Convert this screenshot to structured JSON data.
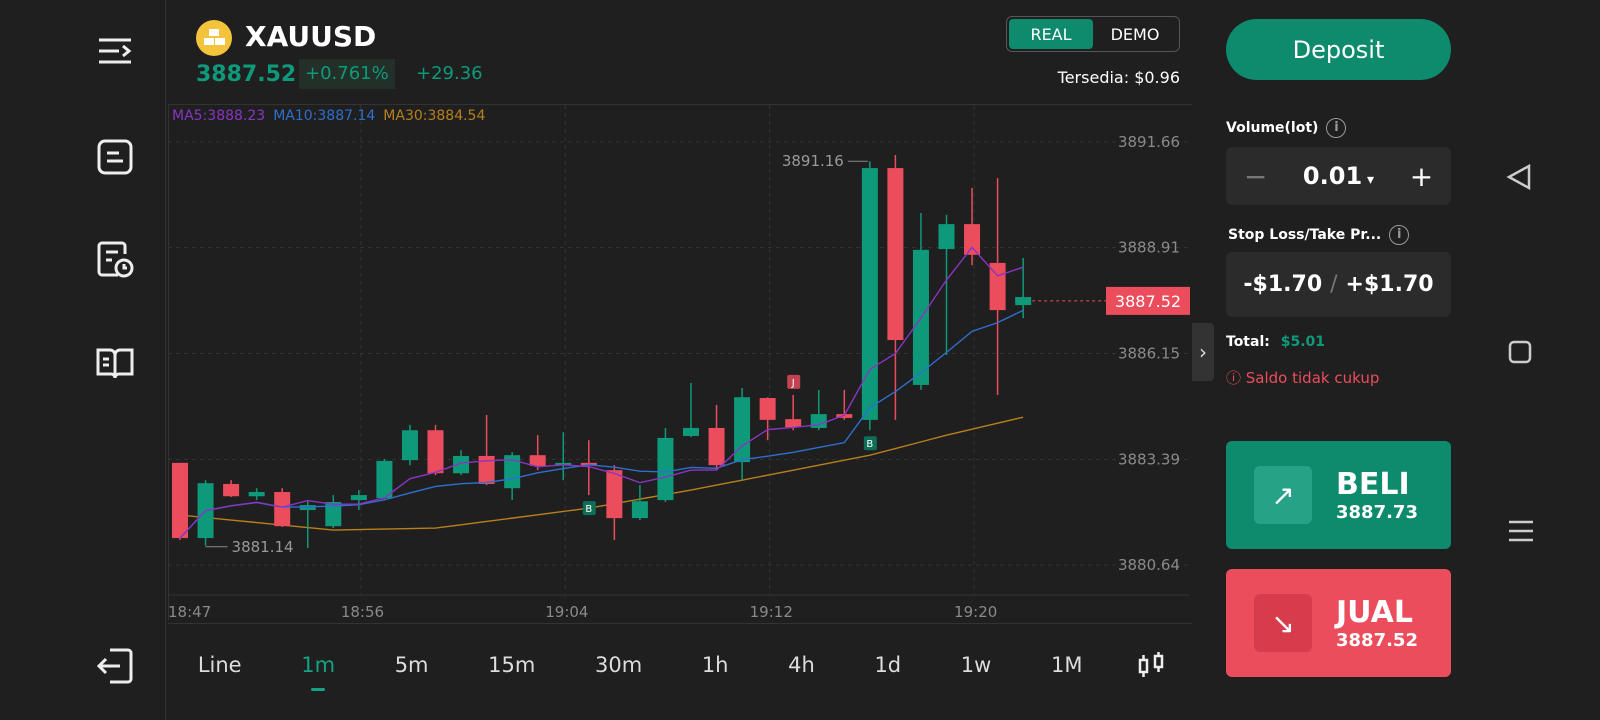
{
  "header": {
    "symbol": "XAUUSD",
    "price": "3887.52",
    "change_pct": "+0.761%",
    "change": "+29.36",
    "account_real": "REAL",
    "account_demo": "DEMO",
    "available": "Tersedia: $0.96"
  },
  "indicators": {
    "ma5": "MA5:3888.23",
    "ma10": "MA10:3887.14",
    "ma30": "MA30:3884.54"
  },
  "colors": {
    "up": "#0e9a7a",
    "down": "#ec4d5c",
    "ma5": "#8a34c4",
    "ma10": "#2e6fd0",
    "ma30": "#b8801c"
  },
  "chart_data": {
    "type": "candlestick",
    "ylim": [
      3880.0,
      3892.6
    ],
    "price_ticks": [
      "3891.66",
      "3888.91",
      "3886.15",
      "3883.39",
      "3880.64"
    ],
    "time_ticks": [
      "18:47",
      "18:56",
      "19:04",
      "19:12",
      "19:20"
    ],
    "time_tick_index": [
      0,
      7,
      15,
      23,
      31
    ],
    "current_price": "3887.52",
    "high_label": "3891.16",
    "high_index": 27,
    "low_label": "3881.14",
    "low_index": 1,
    "markers": [
      {
        "index": 16,
        "label": "B",
        "pos": "below"
      },
      {
        "index": 24,
        "label": "J",
        "pos": "above"
      },
      {
        "index": 27,
        "label": "B",
        "pos": "below"
      }
    ],
    "ohlc": [
      [
        3883.3,
        3883.3,
        3881.29,
        3881.34
      ],
      [
        3881.34,
        3882.85,
        3881.14,
        3882.77
      ],
      [
        3882.75,
        3882.85,
        3882.41,
        3882.43
      ],
      [
        3882.43,
        3882.64,
        3882.33,
        3882.54
      ],
      [
        3882.54,
        3882.64,
        3881.63,
        3881.65
      ],
      [
        3882.07,
        3882.33,
        3881.08,
        3882.2
      ],
      [
        3881.65,
        3882.46,
        3881.6,
        3882.28
      ],
      [
        3882.33,
        3882.59,
        3882.07,
        3882.46
      ],
      [
        3882.38,
        3883.4,
        3882.33,
        3883.35
      ],
      [
        3883.37,
        3884.29,
        3883.24,
        3884.15
      ],
      [
        3884.15,
        3884.29,
        3882.98,
        3883.03
      ],
      [
        3883.03,
        3883.63,
        3882.98,
        3883.48
      ],
      [
        3883.48,
        3884.55,
        3882.72,
        3882.75
      ],
      [
        3882.64,
        3883.58,
        3882.33,
        3883.5
      ],
      [
        3883.5,
        3884.02,
        3883.11,
        3883.22
      ],
      [
        3883.24,
        3884.1,
        3882.85,
        3883.3
      ],
      [
        3883.3,
        3883.89,
        3882.46,
        3883.24
      ],
      [
        3883.11,
        3883.24,
        3881.29,
        3881.86
      ],
      [
        3881.86,
        3882.72,
        3881.81,
        3882.3
      ],
      [
        3882.33,
        3884.21,
        3882.28,
        3883.95
      ],
      [
        3884.0,
        3885.38,
        3883.97,
        3884.21
      ],
      [
        3884.21,
        3884.81,
        3883.11,
        3883.24
      ],
      [
        3883.32,
        3885.25,
        3882.85,
        3885.01
      ],
      [
        3884.99,
        3885.01,
        3883.89,
        3884.42
      ],
      [
        3884.44,
        3885.07,
        3884.15,
        3884.23
      ],
      [
        3884.21,
        3885.2,
        3884.15,
        3884.57
      ],
      [
        3884.57,
        3885.2,
        3884.42,
        3884.47
      ],
      [
        3884.42,
        3891.16,
        3884.15,
        3890.98
      ],
      [
        3890.98,
        3891.32,
        3884.42,
        3886.5
      ],
      [
        3885.33,
        3889.81,
        3885.2,
        3888.85
      ],
      [
        3888.87,
        3889.76,
        3886.11,
        3889.52
      ],
      [
        3889.52,
        3890.46,
        3888.45,
        3888.72
      ],
      [
        3888.51,
        3890.72,
        3885.07,
        3887.28
      ],
      [
        3887.41,
        3888.64,
        3887.07,
        3887.62
      ]
    ],
    "ma30_anchors": [
      [
        0,
        3881.94
      ],
      [
        6,
        3881.55
      ],
      [
        10,
        3881.6
      ],
      [
        16,
        3882.12
      ],
      [
        20,
        3882.59
      ],
      [
        24,
        3883.11
      ],
      [
        27,
        3883.5
      ],
      [
        30,
        3884.02
      ],
      [
        33,
        3884.49
      ]
    ]
  },
  "timeframes": [
    "Line",
    "1m",
    "5m",
    "15m",
    "30m",
    "1h",
    "4h",
    "1d",
    "1w",
    "1M"
  ],
  "active_timeframe": "1m",
  "panel": {
    "deposit": "Deposit",
    "volume_label": "Volume(lot)",
    "volume": "0.01",
    "sltp_label": "Stop Loss/Take Pr...",
    "sl": "-$1.70",
    "sep": "/",
    "tp": "+$1.70",
    "total_label": "Total:",
    "total": "$5.01",
    "warning": "Saldo tidak cukup",
    "buy": "BELI",
    "buy_price": "3887.73",
    "sell": "JUAL",
    "sell_price": "3887.52"
  }
}
